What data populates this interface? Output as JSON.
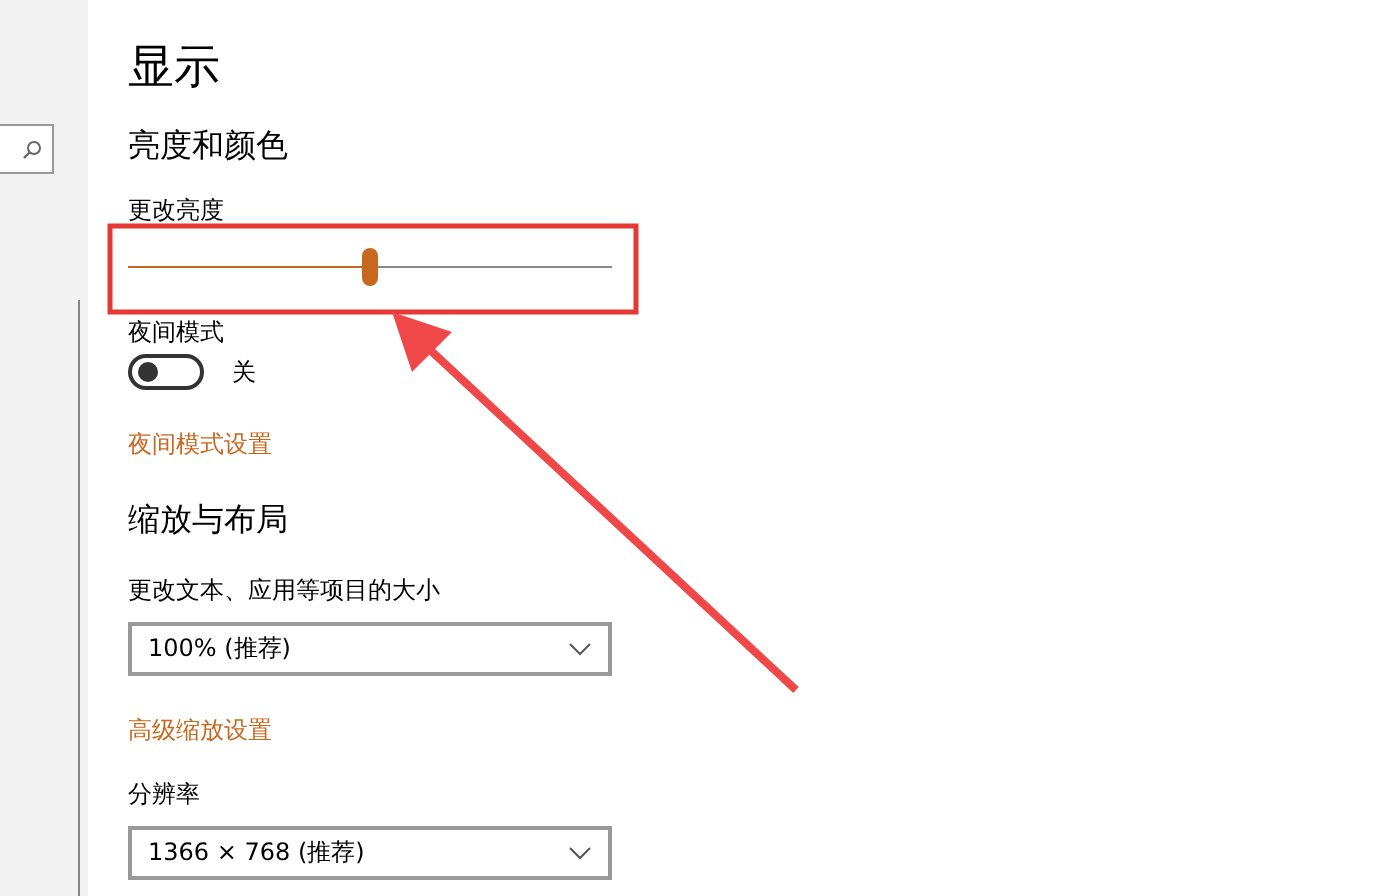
{
  "page": {
    "title": "显示"
  },
  "sections": [
    {
      "heading": "亮度和颜色",
      "items": [
        {
          "kind": "slider",
          "label": "更改亮度",
          "level": 0.5
        },
        {
          "kind": "toggle",
          "label": "夜间模式",
          "on": false,
          "state_text": "关"
        },
        {
          "kind": "link",
          "text": "夜间模式设置"
        }
      ]
    },
    {
      "heading": "缩放与布局",
      "items": [
        {
          "kind": "dropdown",
          "label": "更改文本、应用等项目的大小",
          "value": "100% (推荐)"
        },
        {
          "kind": "link",
          "text": "高级缩放设置"
        },
        {
          "kind": "dropdown",
          "label": "分辨率",
          "value": "1366 × 768 (推荐)"
        }
      ]
    }
  ],
  "annotations": [
    {
      "kind": "box"
    },
    {
      "kind": "arrow"
    }
  ]
}
